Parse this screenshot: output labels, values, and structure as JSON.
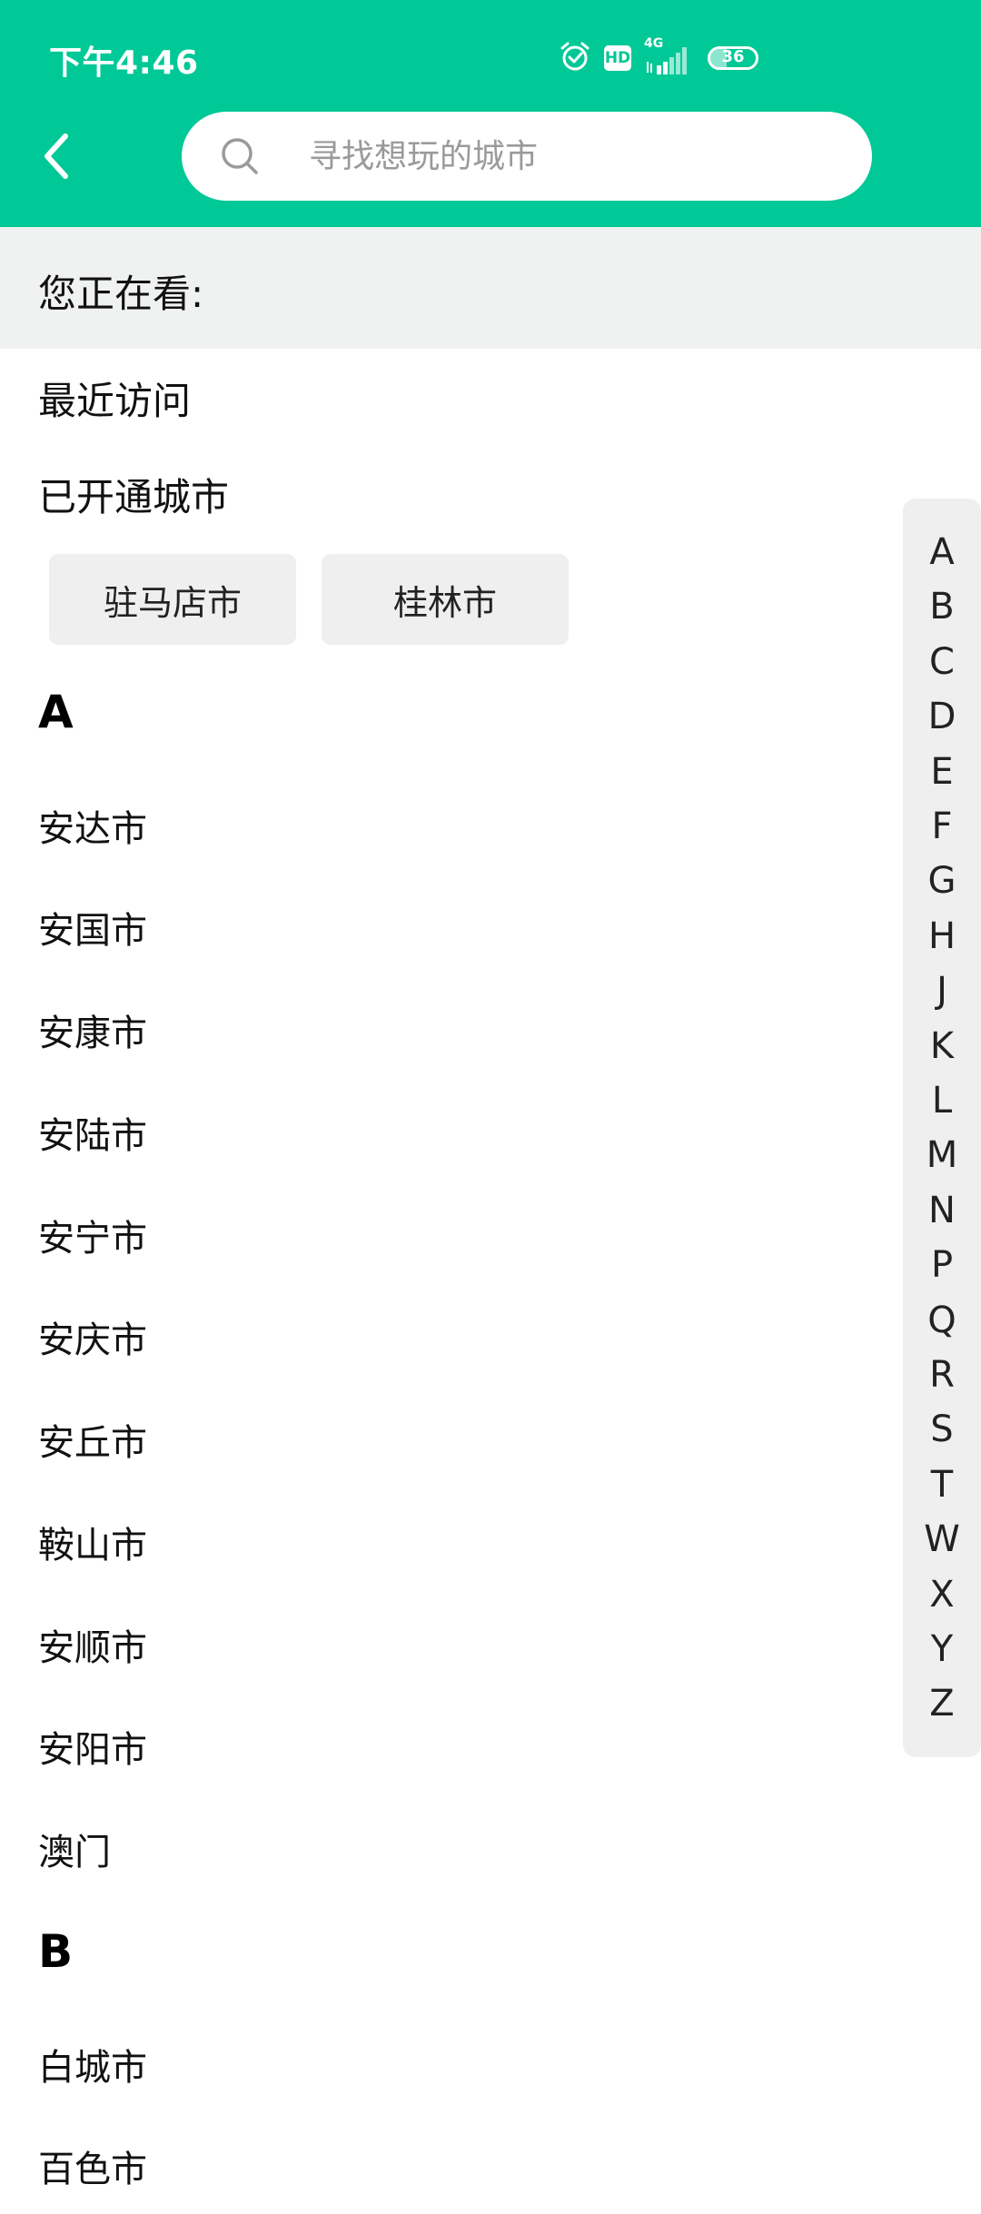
{
  "status_bar": {
    "time": "下午4:46",
    "network_label": "4G",
    "hd_label": "HD",
    "battery_level": "36",
    "icons": [
      "alarm-icon",
      "hd-icon",
      "signal-icon",
      "battery-icon"
    ]
  },
  "header": {
    "background_color": "#00C896",
    "back_icon": "chevron-left-icon",
    "search": {
      "placeholder": "寻找想玩的城市",
      "value": "",
      "icon": "search-icon"
    }
  },
  "viewing": {
    "label": "您正在看:"
  },
  "recent": {
    "label": "最近访问"
  },
  "opened": {
    "label": "已开通城市",
    "cities": [
      "驻马店市",
      "桂林市"
    ]
  },
  "groups": [
    {
      "letter": "A",
      "cities": [
        "安达市",
        "安国市",
        "安康市",
        "安陆市",
        "安宁市",
        "安庆市",
        "安丘市",
        "鞍山市",
        "安顺市",
        "安阳市",
        "澳门"
      ]
    },
    {
      "letter": "B",
      "cities": [
        "白城市",
        "百色市"
      ]
    }
  ],
  "index_bar": {
    "letters": [
      "A",
      "B",
      "C",
      "D",
      "E",
      "F",
      "G",
      "H",
      "J",
      "K",
      "L",
      "M",
      "N",
      "P",
      "Q",
      "R",
      "S",
      "T",
      "W",
      "X",
      "Y",
      "Z"
    ]
  }
}
